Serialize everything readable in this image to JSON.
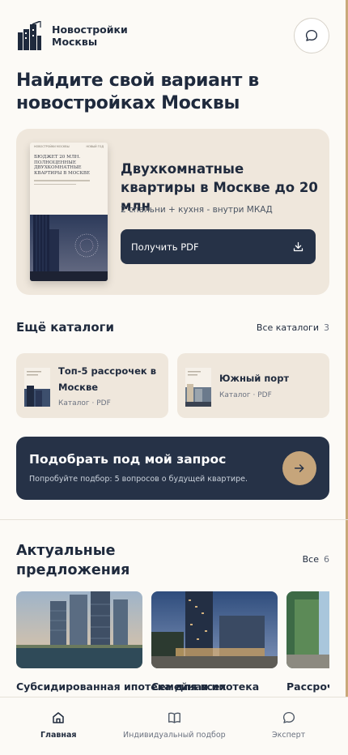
{
  "brand": {
    "name": "Новостройки Москвы"
  },
  "hero": {
    "title": "Найдите свой вариант в новостройках Москвы"
  },
  "promo": {
    "cover_header_left": "НОВОСТРОЙКИ МОСКВЫ",
    "cover_header_right": "НОВЫЙ ГОД",
    "cover_title": "Бюджет 20 млн. Полноценные двухкомнатные квартиры в Москве",
    "heading": "Двухкомнатные квартиры в Москве до 20 млн",
    "subtitle": "2 спальни + кухня - внутри МКАД",
    "button_label": "Получить PDF"
  },
  "catalogs": {
    "title": "Ещё каталоги",
    "all_label": "Все каталоги",
    "all_count": "3",
    "items": [
      {
        "title": "Топ-5 рассрочек в Москве",
        "meta": "Каталог · PDF"
      },
      {
        "title": "Южный порт",
        "meta": "Каталог · PDF"
      }
    ]
  },
  "cta": {
    "title": "Подобрать под мой запрос",
    "subtitle": "Попробуйте подбор: 5 вопросов о будущей квартире."
  },
  "offers": {
    "title": "Актуальные предложения",
    "all_label": "Все",
    "all_count": "6",
    "items": [
      {
        "title": "Субсидированная ипотека для всех"
      },
      {
        "title": "Семейная ипотека"
      },
      {
        "title": "Рассрочка"
      }
    ]
  },
  "tabbar": {
    "items": [
      {
        "label": "Главная",
        "icon": "home-icon"
      },
      {
        "label": "Индивидуальный подбор",
        "icon": "book-icon"
      },
      {
        "label": "Эксперт",
        "icon": "chat-icon"
      }
    ]
  },
  "colors": {
    "navy": "#263247",
    "beige": "#efe7dc",
    "accent": "#c6a57b"
  }
}
